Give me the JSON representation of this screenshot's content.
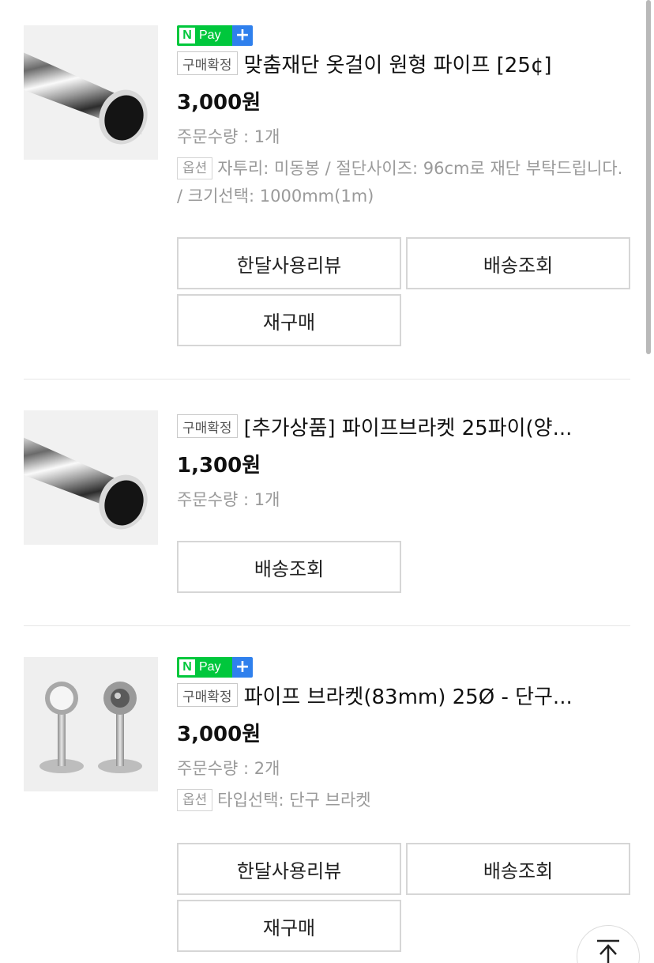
{
  "colors": {
    "npay_green": "#00c73c",
    "npay_blue": "#2f80ed",
    "border": "#d6d6d6",
    "muted": "#9a9a9a"
  },
  "icons": {
    "npay": "naver-pay-plus-icon",
    "scroll_top": "arrow-up-icon"
  },
  "orders": [
    {
      "npay_label": "Pay",
      "badge": "구매확정",
      "title": "맞춤재단 옷걸이 원형 파이프  [25¢]",
      "price": "3,000원",
      "quantity": "주문수량 : 1개",
      "option_badge": "옵션",
      "option_text": "자투리: 미동봉 / 절단사이즈: 96cm로 재단 부탁드립니다. / 크기선택: 1000mm(1m)",
      "buttons": [
        "한달사용리뷰",
        "배송조회",
        "재구매"
      ]
    },
    {
      "badge": "구매확정",
      "title": "[추가상품] 파이프브라켓 25파이(양...",
      "price": "1,300원",
      "quantity": "주문수량 : 1개",
      "buttons": [
        "배송조회"
      ]
    },
    {
      "npay_label": "Pay",
      "badge": "구매확정",
      "title": "파이프 브라켓(83mm) 25Ø - 단구...",
      "price": "3,000원",
      "quantity": "주문수량 : 2개",
      "option_badge": "옵션",
      "option_text": "타입선택: 단구 브라켓",
      "buttons": [
        "한달사용리뷰",
        "배송조회",
        "재구매"
      ]
    }
  ]
}
